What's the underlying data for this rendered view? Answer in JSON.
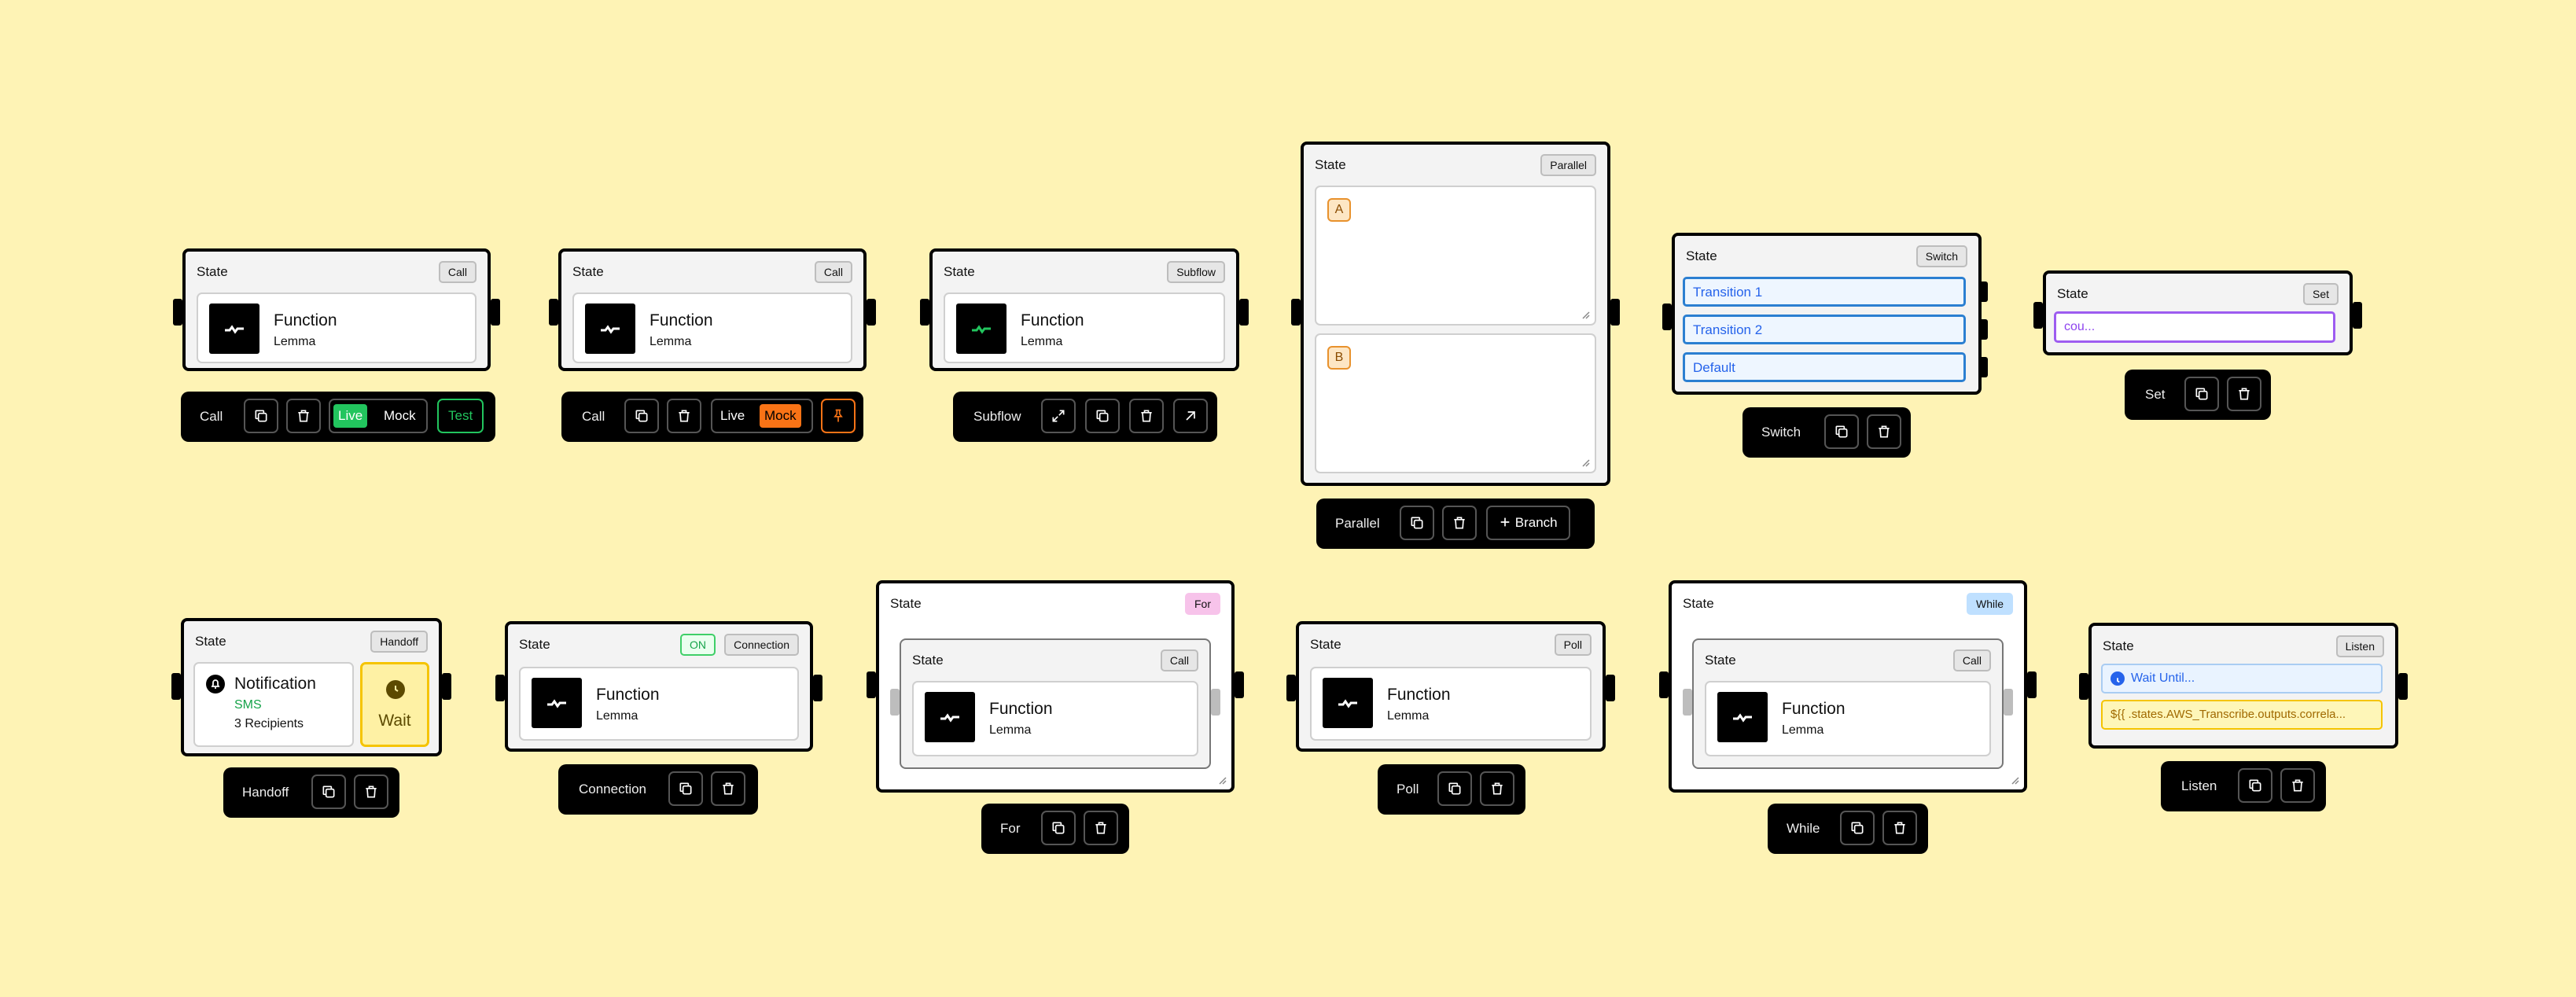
{
  "colors": {
    "background": "#fef3b5",
    "live": "#22c55e",
    "mock": "#f97316",
    "transition": "#2b7fd1",
    "set": "#9d5cf0"
  },
  "icons": {
    "copy": "copy-icon",
    "delete": "trash-icon",
    "expand": "expand-icon",
    "open": "arrow-up-right-icon",
    "pin": "pin-icon",
    "plus": "plus-icon",
    "bell": "bell-icon",
    "clock": "clock-icon"
  },
  "call1": {
    "state": "State",
    "badge": "Call",
    "fn_title": "Function",
    "fn_sub": "Lemma",
    "toolbar": {
      "label": "Call",
      "live": "Live",
      "mock": "Mock",
      "test": "Test"
    }
  },
  "call2": {
    "state": "State",
    "badge": "Call",
    "fn_title": "Function",
    "fn_sub": "Lemma",
    "toolbar": {
      "label": "Call",
      "live": "Live",
      "mock": "Mock"
    }
  },
  "subflow": {
    "state": "State",
    "badge": "Subflow",
    "fn_title": "Function",
    "fn_sub": "Lemma",
    "toolbar": {
      "label": "Subflow"
    }
  },
  "parallel": {
    "state": "State",
    "badge": "Parallel",
    "branch_a": "A",
    "branch_b": "B",
    "toolbar": {
      "label": "Parallel",
      "branch": "Branch"
    }
  },
  "switch": {
    "state": "State",
    "badge": "Switch",
    "transitions": [
      "Transition 1",
      "Transition 2",
      "Default"
    ],
    "toolbar": {
      "label": "Switch"
    }
  },
  "set": {
    "state": "State",
    "badge": "Set",
    "field": "cou...",
    "toolbar": {
      "label": "Set"
    }
  },
  "handoff": {
    "state": "State",
    "badge": "Handoff",
    "title": "Notification",
    "channel": "SMS",
    "recipients": "3 Recipients",
    "wait": "Wait",
    "toolbar": {
      "label": "Handoff"
    }
  },
  "connection": {
    "state": "State",
    "on": "ON",
    "badge": "Connection",
    "fn_title": "Function",
    "fn_sub": "Lemma",
    "toolbar": {
      "label": "Connection"
    }
  },
  "for": {
    "state": "State",
    "badge": "For",
    "inner_state": "State",
    "inner_badge": "Call",
    "fn_title": "Function",
    "fn_sub": "Lemma",
    "toolbar": {
      "label": "For"
    }
  },
  "poll": {
    "state": "State",
    "badge": "Poll",
    "fn_title": "Function",
    "fn_sub": "Lemma",
    "toolbar": {
      "label": "Poll"
    }
  },
  "while": {
    "state": "State",
    "badge": "While",
    "inner_state": "State",
    "inner_badge": "Call",
    "fn_title": "Function",
    "fn_sub": "Lemma",
    "toolbar": {
      "label": "While"
    }
  },
  "listen": {
    "state": "State",
    "badge": "Listen",
    "wait_until": "Wait Until...",
    "expr": "${{ .states.AWS_Transcribe.outputs.correla...",
    "toolbar": {
      "label": "Listen"
    }
  }
}
